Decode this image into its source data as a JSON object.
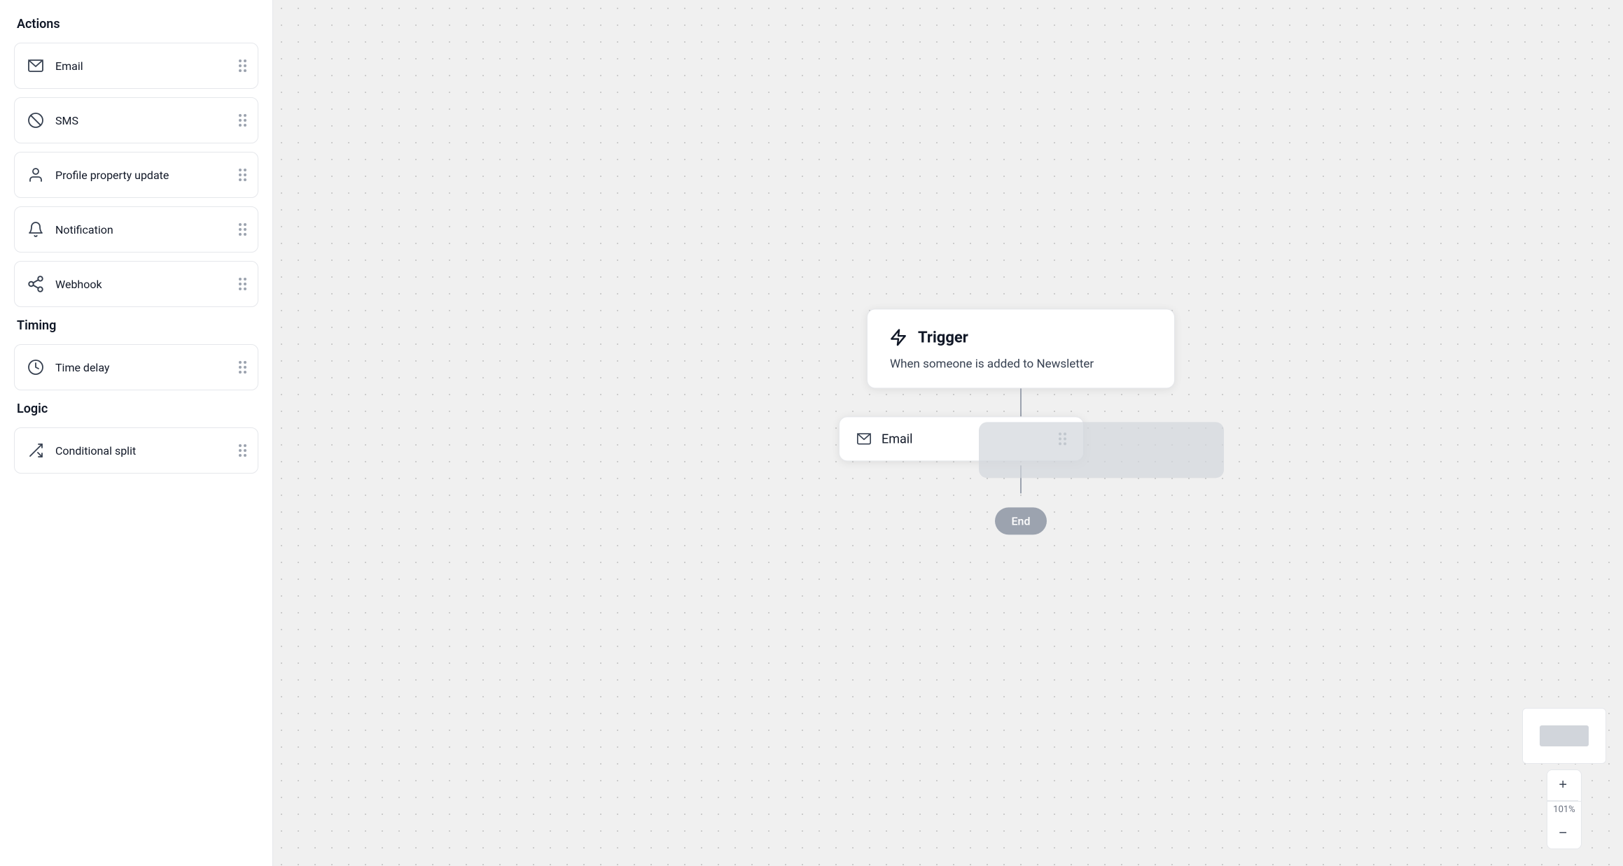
{
  "sidebar": {
    "actions_title": "Actions",
    "timing_title": "Timing",
    "logic_title": "Logic",
    "items": [
      {
        "id": "email",
        "label": "Email",
        "icon": "email-icon"
      },
      {
        "id": "sms",
        "label": "SMS",
        "icon": "sms-icon"
      },
      {
        "id": "profile-property-update",
        "label": "Profile property update",
        "icon": "profile-icon"
      },
      {
        "id": "notification",
        "label": "Notification",
        "icon": "notification-icon"
      },
      {
        "id": "webhook",
        "label": "Webhook",
        "icon": "webhook-icon"
      }
    ],
    "timing_items": [
      {
        "id": "time-delay",
        "label": "Time delay",
        "icon": "clock-icon"
      }
    ],
    "logic_items": [
      {
        "id": "conditional-split",
        "label": "Conditional split",
        "icon": "split-icon"
      }
    ]
  },
  "canvas": {
    "trigger": {
      "title": "Trigger",
      "description": "When someone is added to Newsletter"
    },
    "email_node": {
      "label": "Email"
    },
    "end_node": {
      "label": "End"
    },
    "zoom_level": "101%"
  }
}
